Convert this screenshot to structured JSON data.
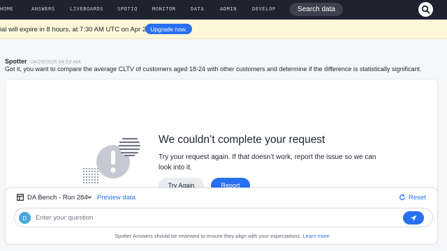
{
  "nav": {
    "items": [
      "HOME",
      "ANSWERS",
      "LIVEBOARDS",
      "SPOTIQ",
      "MONITOR",
      "DATA",
      "ADMIN",
      "DEVELOP"
    ],
    "search_label": "Search data"
  },
  "banner": {
    "text": "ial will expire in 8 hours, at 7:30 AM UTC on Apr 29.",
    "upgrade_label": "Upgrade now."
  },
  "message": {
    "author": "Spotter",
    "timestamp": "04/29/2025 04:53 AM",
    "text": "Got it, you want to compare the average CLTV of customers aged 18-24 with other customers and determine if the difference is statistically significant."
  },
  "error_card": {
    "title": "We couldn’t complete your request",
    "body": "Try your request again. If that doesn’t work, report the issue so we can look into it.",
    "try_again_label": "Try Again",
    "report_label": "Report"
  },
  "input_panel": {
    "datasource": "DA Bench - Run 284",
    "preview_label": "Preview data",
    "reset_label": "Reset",
    "avatar_initial": "D",
    "placeholder": "Enter your question",
    "disclaimer": "Spotter Answers should be reviewed to ensure they align with your expectations.",
    "learn_more": "Learn more"
  },
  "colors": {
    "nav_bg": "#1d232f",
    "banner_bg": "#fdf6d9",
    "accent_blue": "#2770ef",
    "avatar_bg": "#48a8d9"
  },
  "icons": [
    "search-icon",
    "table-icon",
    "chevron-down-icon",
    "reset-icon",
    "send-icon",
    "error-illustration"
  ]
}
